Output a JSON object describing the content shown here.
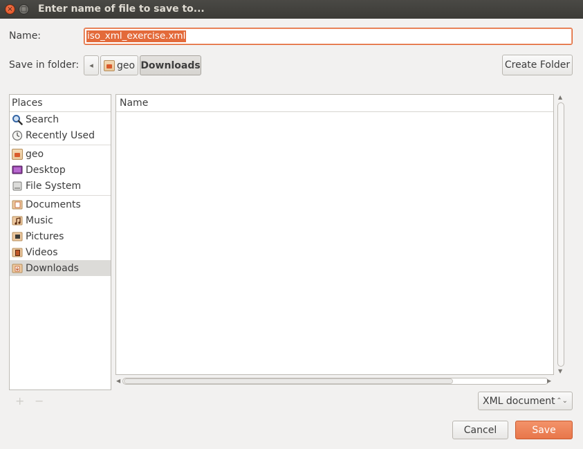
{
  "window": {
    "title": "Enter name of file to save to...",
    "close_symbol": "×",
    "max_symbol": "□"
  },
  "name_field": {
    "label": "Name:",
    "value": "iso_xml_exercise.xml"
  },
  "save_in": {
    "label": "Save in folder:",
    "back_symbol": "◂",
    "path": [
      "geo",
      "Downloads"
    ]
  },
  "create_folder": "Create Folder",
  "places": {
    "header": "Places",
    "items": [
      {
        "label": "Search",
        "icon": "search-icon"
      },
      {
        "label": "Recently Used",
        "icon": "recent-icon"
      },
      {
        "label": "geo",
        "icon": "home-folder-icon"
      },
      {
        "label": "Desktop",
        "icon": "desktop-icon"
      },
      {
        "label": "File System",
        "icon": "drive-icon"
      },
      {
        "label": "Documents",
        "icon": "documents-icon"
      },
      {
        "label": "Music",
        "icon": "music-icon"
      },
      {
        "label": "Pictures",
        "icon": "pictures-icon"
      },
      {
        "label": "Videos",
        "icon": "videos-icon"
      },
      {
        "label": "Downloads",
        "icon": "downloads-icon"
      }
    ],
    "selected": "Downloads"
  },
  "file_list": {
    "header": "Name"
  },
  "add_symbol": "+",
  "remove_symbol": "−",
  "filter": {
    "value": "XML document",
    "spinner": "⌃⌄"
  },
  "buttons": {
    "cancel": "Cancel",
    "save": "Save"
  },
  "colors": {
    "accent": "#e36a3a",
    "titlebar": "#3c3b37",
    "selection": "#dcdbd8"
  }
}
